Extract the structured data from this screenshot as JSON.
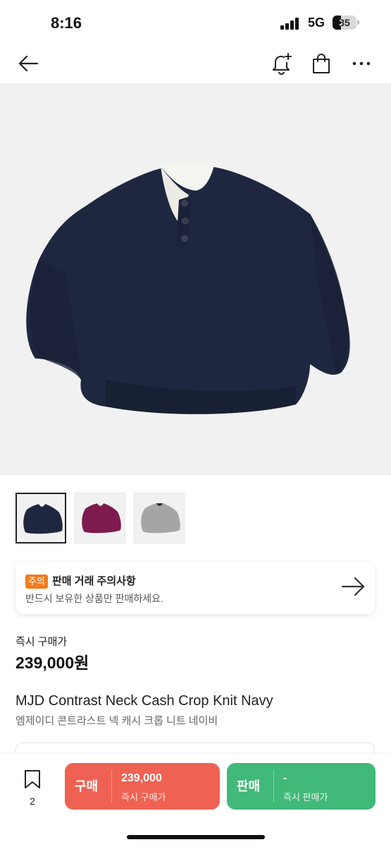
{
  "status_bar": {
    "time": "8:16",
    "network": "5G",
    "battery_level": "35"
  },
  "nav": {
    "back_icon": "arrow-left-icon",
    "bell_icon": "bell-plus-icon",
    "bag_icon": "shopping-bag-icon",
    "more_icon": "more-dots-icon"
  },
  "product_image": {
    "color": "#1f2740",
    "background": "#f1f1f1"
  },
  "thumbnails": [
    {
      "color": "#1f2740",
      "selected": true
    },
    {
      "color": "#7d1a4f",
      "selected": false
    },
    {
      "color": "#a5a5a5",
      "selected": false
    }
  ],
  "notice": {
    "badge": "주의",
    "title": "판매 거래 주의사항",
    "subtitle": "반드시 보유한 상품만 판매하세요.",
    "badge_color": "#f07c1e"
  },
  "price": {
    "label": "즉시 구매가",
    "value": "239,000원"
  },
  "product": {
    "name": "MJD Contrast Neck Cash Crop Knit Navy",
    "name_ko": "엠제이디 콘트라스트 넥 캐시 크롭 니트 네이비"
  },
  "bottom_bar": {
    "bookmark_count": "2",
    "buy": {
      "label": "구매",
      "price": "239,000",
      "sub": "즉시 구매가",
      "color": "#ef6253"
    },
    "sell": {
      "label": "판매",
      "price": "-",
      "sub": "즉시 판매가",
      "color": "#41b979"
    }
  }
}
